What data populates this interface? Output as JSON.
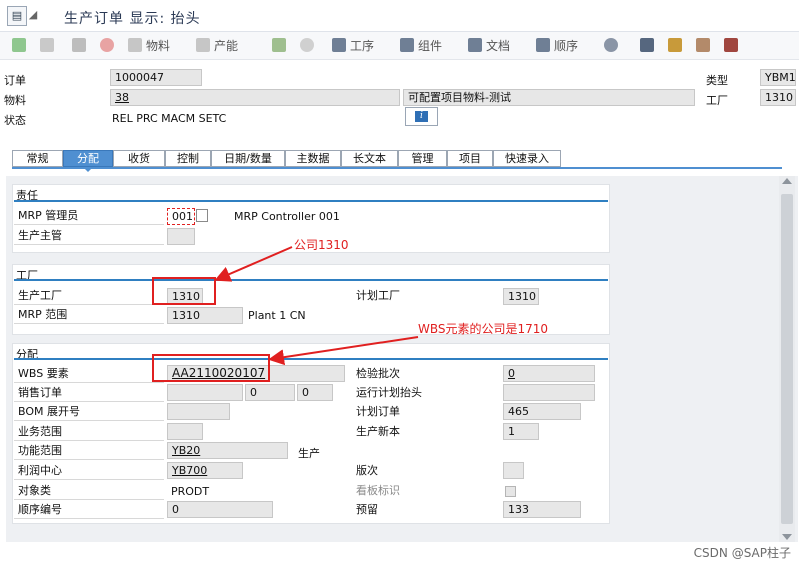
{
  "window": {
    "title": "生产订单 显示: 抬头"
  },
  "toolbar": {
    "items": [
      {
        "label": "",
        "icon": "flag-icon"
      },
      {
        "label": "",
        "icon": "copy-icon"
      },
      {
        "label": "",
        "icon": "calculator-icon"
      },
      {
        "label": "",
        "icon": "lifebuoy-icon"
      },
      {
        "label": "物料",
        "icon": "material-icon"
      },
      {
        "label": "产能",
        "icon": "capacity-icon"
      },
      {
        "label": "",
        "icon": "hierarchy-icon"
      },
      {
        "label": "",
        "icon": "cloud-icon"
      },
      {
        "label": "工序",
        "icon": "operations-icon"
      },
      {
        "label": "组件",
        "icon": "components-icon"
      },
      {
        "label": "文档",
        "icon": "documents-icon"
      },
      {
        "label": "顺序",
        "icon": "sequence-icon"
      },
      {
        "label": "",
        "icon": "settings-gear-icon"
      },
      {
        "label": "",
        "icon": "columns-icon"
      },
      {
        "label": "",
        "icon": "tree-icon"
      },
      {
        "label": "",
        "icon": "grid-icon"
      },
      {
        "label": "",
        "icon": "table-icon"
      }
    ]
  },
  "header": {
    "order_label": "订单",
    "order_value": "1000047",
    "material_label": "物料",
    "material_value": "38",
    "material_desc": "可配置项目物料-测试",
    "status_label": "状态",
    "status_value": "REL  PRC  MACM SETC",
    "type_label": "类型",
    "type_value": "YBM1",
    "plant_label": "工厂",
    "plant_value": "1310"
  },
  "tabs": [
    "常规",
    "分配",
    "收货",
    "控制",
    "日期/数量",
    "主数据",
    "长文本",
    "管理",
    "项目",
    "快速录入"
  ],
  "active_tab": "分配",
  "responsibility": {
    "title": "责任",
    "mrp_controller_label": "MRP 管理员",
    "mrp_controller_value": "001",
    "mrp_controller_desc": "MRP Controller 001",
    "prod_supervisor_label": "生产主管",
    "prod_supervisor_value": ""
  },
  "plant_group": {
    "title": "工厂",
    "prod_plant_label": "生产工厂",
    "prod_plant_value": "1310",
    "planning_plant_label": "计划工厂",
    "planning_plant_value": "1310",
    "mrp_area_label": "MRP 范围",
    "mrp_area_value": "1310",
    "mrp_area_desc": "Plant 1 CN"
  },
  "assignment": {
    "title": "分配",
    "wbs_label": "WBS 要素",
    "wbs_value": "AA2110020107",
    "inspection_lot_label": "检验批次",
    "inspection_lot_value": "0",
    "sales_order_label": "销售订单",
    "sales_order_item1": "0",
    "sales_order_item2": "0",
    "run_schedule_label": "运行计划抬头",
    "run_schedule_value": "",
    "bom_exp_label": "BOM 展开号",
    "bom_exp_value": "",
    "planned_order_label": "计划订单",
    "planned_order_value": "465",
    "business_area_label": "业务范围",
    "business_area_value": "",
    "prod_version_label": "生产新本",
    "prod_version_value": "1",
    "func_area_label": "功能范围",
    "func_area_value": "YB20",
    "func_area_desc": "生产",
    "profit_center_label": "利润中心",
    "profit_center_value": "YB700",
    "version_label": "版次",
    "version_value": "",
    "object_class_label": "对象类",
    "object_class_value": "PRODT",
    "kanban_label": "看板标识",
    "seq_no_label": "顺序编号",
    "seq_no_value": "0",
    "reservation_label": "预留",
    "reservation_value": "133"
  },
  "annotations": {
    "company1": "公司1310",
    "company2": "WBS元素的公司是1710"
  },
  "watermark": "CSDN @SAP柱子",
  "colors": {
    "active_tab": "#4f8fd1",
    "annotation": "#e02020",
    "group_line": "#2f7fc1"
  }
}
